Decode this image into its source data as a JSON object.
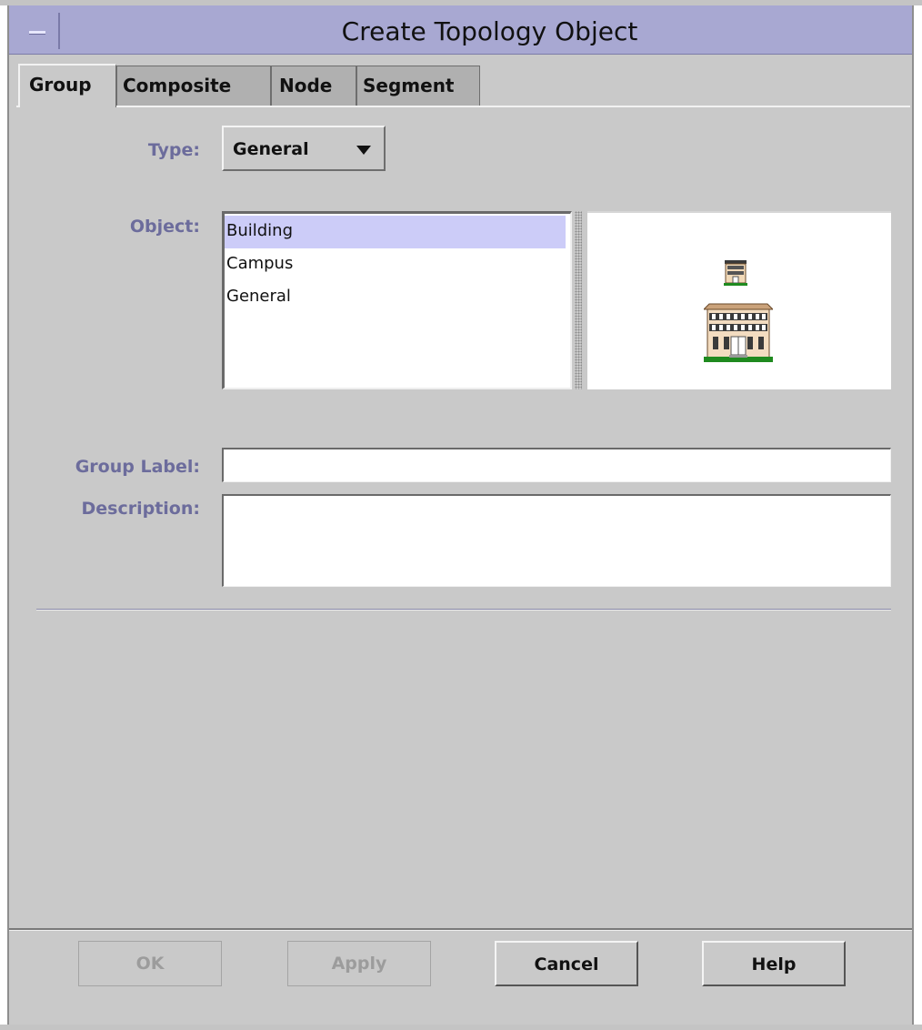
{
  "window": {
    "title": "Create Topology Object"
  },
  "tabs": [
    {
      "label": "Group",
      "active": true
    },
    {
      "label": "Composite",
      "active": false
    },
    {
      "label": "Node",
      "active": false
    },
    {
      "label": "Segment",
      "active": false
    }
  ],
  "form": {
    "type_label": "Type:",
    "type_value": "General",
    "object_label": "Object:",
    "object_items": [
      {
        "label": "Building",
        "selected": true
      },
      {
        "label": "Campus",
        "selected": false
      },
      {
        "label": "General",
        "selected": false
      }
    ],
    "preview_icons": [
      "building-small-icon",
      "building-large-icon"
    ],
    "group_label_label": "Group Label:",
    "group_label_value": "",
    "description_label": "Description:",
    "description_value": ""
  },
  "buttons": {
    "ok": "OK",
    "apply": "Apply",
    "cancel": "Cancel",
    "help": "Help"
  },
  "colors": {
    "titlebar": "#a8a8d2",
    "label_text": "#6c6c9c",
    "selection": "#ccccf8",
    "window_bg": "#c9c9c9"
  }
}
